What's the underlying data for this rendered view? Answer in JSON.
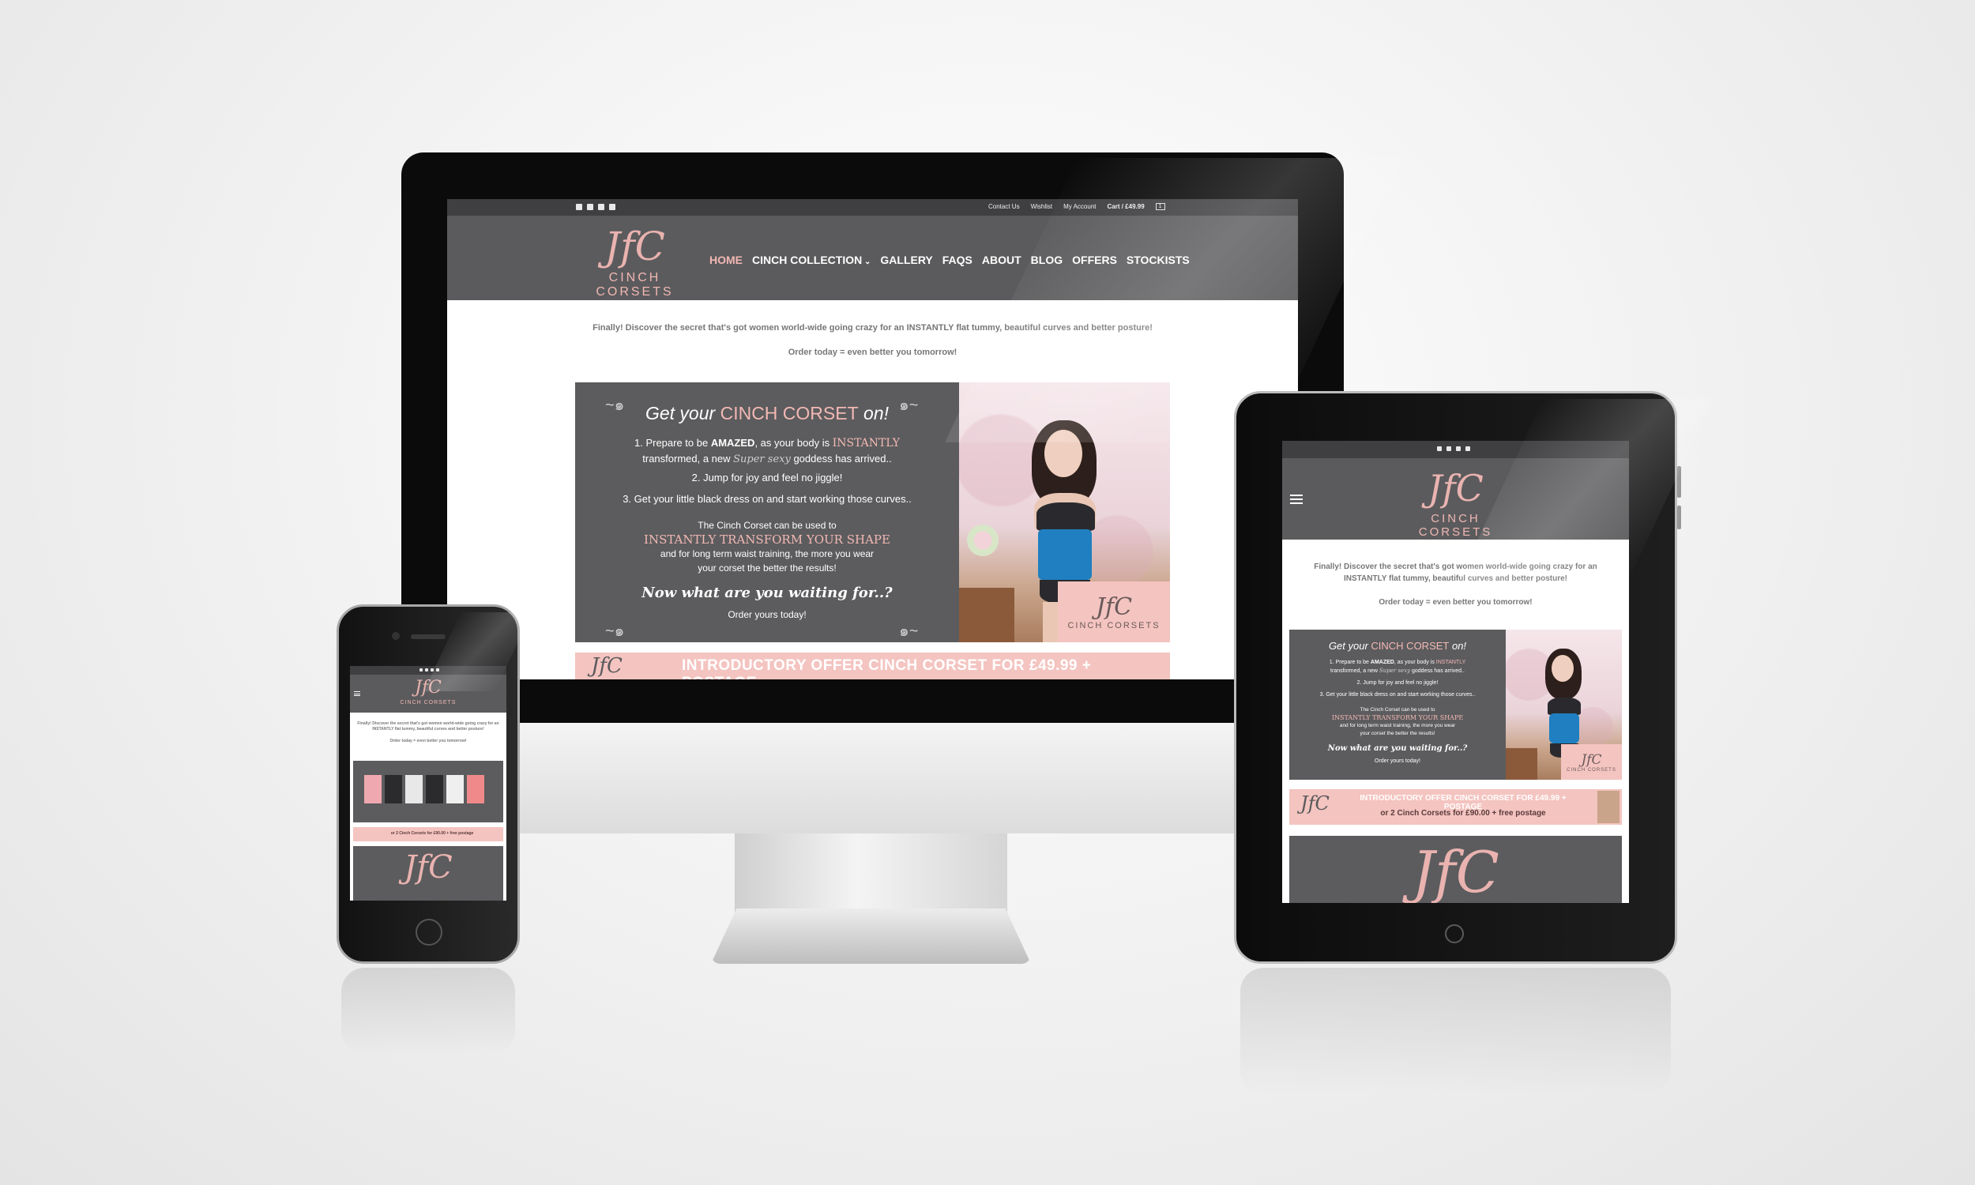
{
  "site": {
    "logo_monogram": "JfC",
    "logo_name": "CINCH CORSETS",
    "top_links": [
      "Contact Us",
      "Wishlist",
      "My Account"
    ],
    "cart": "Cart / £49.99",
    "cart_count": "1",
    "nav": [
      "HOME",
      "CINCH COLLECTION",
      "GALLERY",
      "FAQS",
      "ABOUT",
      "BLOG",
      "OFFERS",
      "STOCKISTS"
    ],
    "nav_chevron": "chevron-down-icon",
    "intro_text": "Finally! Discover the secret that's got women world-wide going crazy for an INSTANTLY flat tummy, beautiful curves and better posture!",
    "order_text": "Order today = even better you tomorrow!",
    "banner": {
      "heading_pre": "Get your ",
      "heading_em": "CINCH CORSET",
      "heading_post": " on!",
      "step1_pre": "1. Prepare to be ",
      "step1_bold": "AMAZED",
      "step1_mid": ", as your body is ",
      "step1_pink": "INSTANTLY",
      "step1_line2_pre": "transformed, a new ",
      "step1_script": "Super sexy",
      "step1_line2_post": " goddess has arrived..",
      "step2": "2. Jump for joy and feel no jiggle!",
      "step3": "3. Get your little black dress on and start working those curves..",
      "use_line1": "The Cinch Corset can be used to",
      "use_highlight": "INSTANTLY TRANSFORM YOUR SHAPE",
      "use_line2": "and for long term waist training, the more you wear",
      "use_line3": "your corset the better the results!",
      "waiting": "Now what are you waiting for..?",
      "order_yours": "Order yours today!"
    },
    "offer_line1": "INTRODUCTORY OFFER CINCH CORSET FOR £49.99 + POSTAGE",
    "offer_line2": "or 2 Cinch Corsets for £90.00 + free postage",
    "social_icons": [
      "facebook-icon",
      "twitter-icon",
      "instagram-icon",
      "youtube-icon"
    ],
    "menu_icon": "hamburger-menu-icon"
  },
  "colors": {
    "accent_pink": "#f3b8b4",
    "header_grey": "#5b5b5d",
    "topbar_grey": "#3f3f41",
    "corset_blue": "#1f7fc0"
  }
}
